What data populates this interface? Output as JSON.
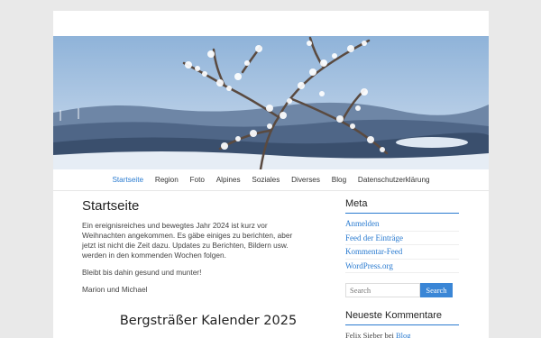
{
  "nav": {
    "items": [
      {
        "label": "Startseite",
        "active": true
      },
      {
        "label": "Region"
      },
      {
        "label": "Foto"
      },
      {
        "label": "Alpines"
      },
      {
        "label": "Soziales"
      },
      {
        "label": "Diverses"
      },
      {
        "label": "Blog"
      },
      {
        "label": "Datenschutzerklärung"
      }
    ]
  },
  "main": {
    "title": "Startseite",
    "paragraphs": [
      "Ein ereignisreiches und bewegtes Jahr 2024 ist kurz vor Weihnachten angekommen. Es gäbe einiges zu berichten, aber jetzt ist nicht die Zeit dazu. Updates zu Berichten, Bildern usw. werden in den kommenden Wochen folgen.",
      "Bleibt bis dahin gesund und munter!",
      "Marion und Michael"
    ],
    "calendar_title": "Bergsträßer Kalender 2025"
  },
  "sidebar": {
    "meta_title": "Meta",
    "meta_links": [
      "Anmelden",
      "Feed der Einträge",
      "Kommentar-Feed",
      "WordPress.org"
    ],
    "search_placeholder": "Search",
    "search_button": "Search",
    "comments_title": "Neueste Kommentare",
    "comment_prefix": "Felix Sieber bei",
    "comment_link": "Blog"
  },
  "colors": {
    "accent": "#2a7bd0",
    "page_bg": "#e9e9e9"
  }
}
